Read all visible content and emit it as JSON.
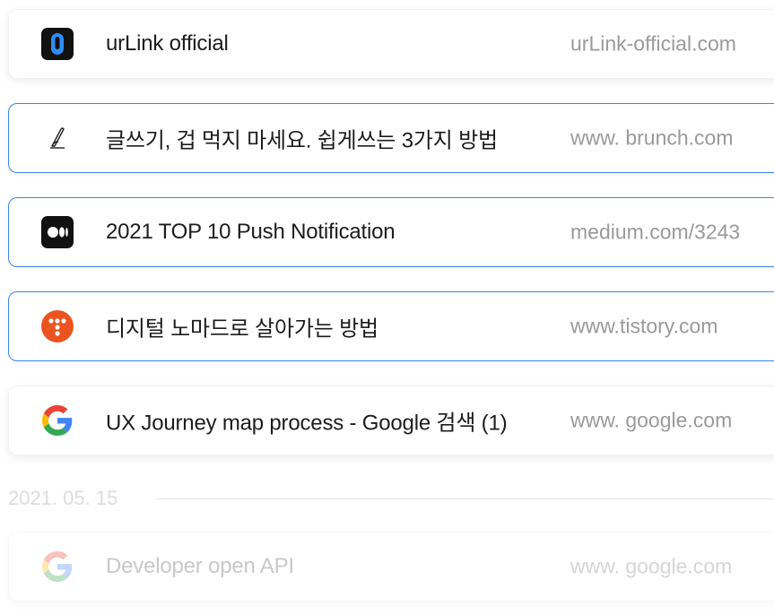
{
  "colors": {
    "selected_border": "#3b86e8",
    "title_text": "#1c1c1c",
    "domain_text": "#9a9a9a",
    "faded_text": "#c9c9c9"
  },
  "links": [
    {
      "title": "urLink official",
      "domain": "urLink-official.com",
      "icon": "urlink-logo-icon",
      "state": "default"
    },
    {
      "title": "글쓰기, 겁 먹지 마세요. 쉽게쓰는 3가지 방법",
      "domain": "www. brunch.com",
      "icon": "brunch-pen-icon",
      "state": "selected"
    },
    {
      "title": "2021 TOP 10 Push Notification",
      "domain": "medium.com/3243",
      "icon": "medium-logo-icon",
      "state": "selected"
    },
    {
      "title": "디지털 노마드로 살아가는 방법",
      "domain": "www.tistory.com",
      "icon": "tistory-logo-icon",
      "state": "selected"
    },
    {
      "title": "UX Journey map process - Google 검색 (1)",
      "domain": "www. google.com",
      "icon": "google-logo-icon",
      "state": "default"
    }
  ],
  "date_group": {
    "label": "2021. 05. 15"
  },
  "links_older": [
    {
      "title": "Developer open API",
      "domain": "www. google.com",
      "icon": "google-logo-icon",
      "state": "faded"
    }
  ]
}
